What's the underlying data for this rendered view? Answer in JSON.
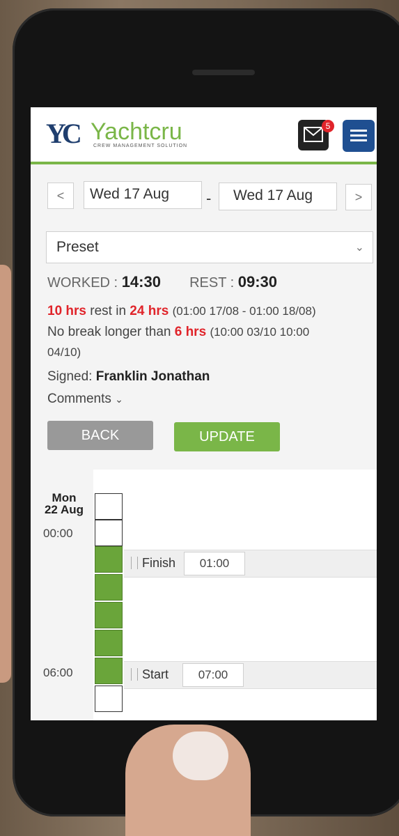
{
  "brand": {
    "logo_mark": "YC",
    "name": "Yachtcru",
    "tagline": "CREW MANAGEMENT SOLUTION",
    "accent": "#7ab648",
    "primary": "#1f4f91"
  },
  "header": {
    "mail_icon": "envelope-icon",
    "mail_badge": "5",
    "menu_icon": "hamburger-icon"
  },
  "date_nav": {
    "prev": "<",
    "from_date": "Wed 17 Aug",
    "separator": "-",
    "to_date": "Wed 17 Aug",
    "next": ">"
  },
  "preset": {
    "selected": "Preset",
    "chevron": "⌄"
  },
  "stats": {
    "worked_label": "WORKED :",
    "worked_value": "14:30",
    "rest_label": "REST :",
    "rest_value": "09:30"
  },
  "rules": {
    "rest_hrs": "10 hrs",
    "rest_in": "rest in",
    "rest_window": "24 hrs",
    "rest_range": "(01:00 17/08 - 01:00 18/08)",
    "break_text": "No break longer than",
    "break_hrs": "6 hrs",
    "break_range_1": "(10:00 03/10 10:00",
    "break_range_2": "04/10)"
  },
  "signed": {
    "label": "Signed:",
    "name": "Franklin Jonathan"
  },
  "comments": {
    "label": "Comments",
    "chevron": "⌄"
  },
  "actions": {
    "back": "BACK",
    "update": "UPDATE"
  },
  "schedule": {
    "day_name": "Mon",
    "day_date": "22 Aug",
    "time_0": "00:00",
    "time_6": "06:00",
    "entries": [
      {
        "label": "Finish",
        "value": "01:00"
      },
      {
        "label": "Start",
        "value": "07:00"
      }
    ]
  }
}
